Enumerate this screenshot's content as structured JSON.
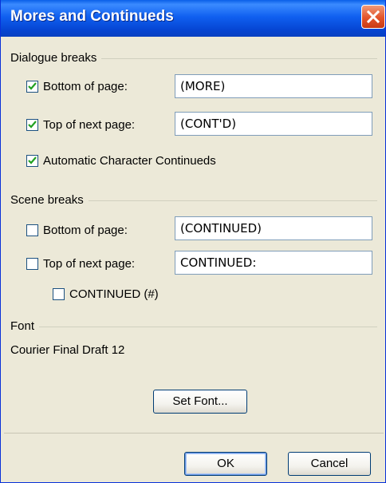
{
  "window": {
    "title": "Mores and Continueds",
    "close_icon": "close-icon"
  },
  "dialogue_breaks": {
    "label": "Dialogue breaks",
    "bottom_of_page": {
      "label": "Bottom of page:",
      "checked": true,
      "value": "(MORE)"
    },
    "top_of_next_page": {
      "label": "Top of next page:",
      "checked": true,
      "value": "(CONT'D)"
    },
    "auto_continueds": {
      "label": "Automatic Character Continueds",
      "checked": true
    }
  },
  "scene_breaks": {
    "label": "Scene breaks",
    "bottom_of_page": {
      "label": "Bottom of page:",
      "checked": false,
      "value": "(CONTINUED)"
    },
    "top_of_next_page": {
      "label": "Top of next page:",
      "checked": false,
      "value": "CONTINUED:"
    },
    "continued_number": {
      "label": "CONTINUED (#)",
      "checked": false
    }
  },
  "font": {
    "label": "Font",
    "value": "Courier Final Draft 12",
    "set_font_label": "Set Font..."
  },
  "buttons": {
    "ok_label": "OK",
    "cancel_label": "Cancel"
  },
  "colors": {
    "title_bar": "#0a5fe8",
    "close_button": "#e2532a",
    "dialog_bg": "#ece9d8",
    "checkbox_check": "#21a121"
  }
}
